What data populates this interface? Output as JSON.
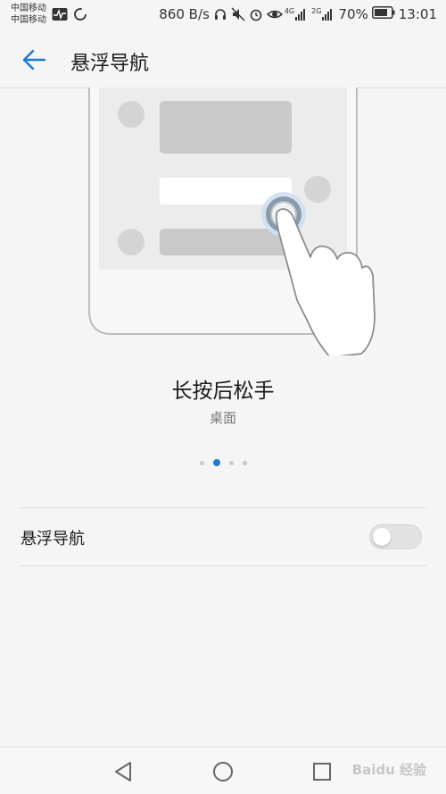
{
  "status_bar": {
    "carrier_1": "中国移动",
    "carrier_2": "中国移动",
    "net_speed": "860 B/s",
    "network_1": "4G",
    "network_2": "2G",
    "battery": "70%",
    "time": "13:01",
    "icons": [
      "activity-icon",
      "sync-icon",
      "headset-icon",
      "mute-icon",
      "alarm-icon",
      "eye-icon",
      "signal-icon",
      "signal-icon",
      "battery-icon"
    ]
  },
  "header": {
    "title": "悬浮导航",
    "back_icon": "arrow-left-icon"
  },
  "illustration": {
    "gesture": "long-press",
    "accent_color": "#1a7cd6"
  },
  "caption": {
    "title": "长按后松手",
    "subtitle": "桌面"
  },
  "pager": {
    "count": 4,
    "active_index": 1
  },
  "setting": {
    "label": "悬浮导航",
    "enabled": false
  },
  "navbar": {
    "buttons": [
      "back-triangle-icon",
      "home-circle-icon",
      "recents-square-icon"
    ],
    "watermark": "Baidu 经验"
  },
  "colors": {
    "background": "#f5f5f5",
    "accent": "#1a7cd6",
    "toggle_off": "#e2e2e2"
  }
}
